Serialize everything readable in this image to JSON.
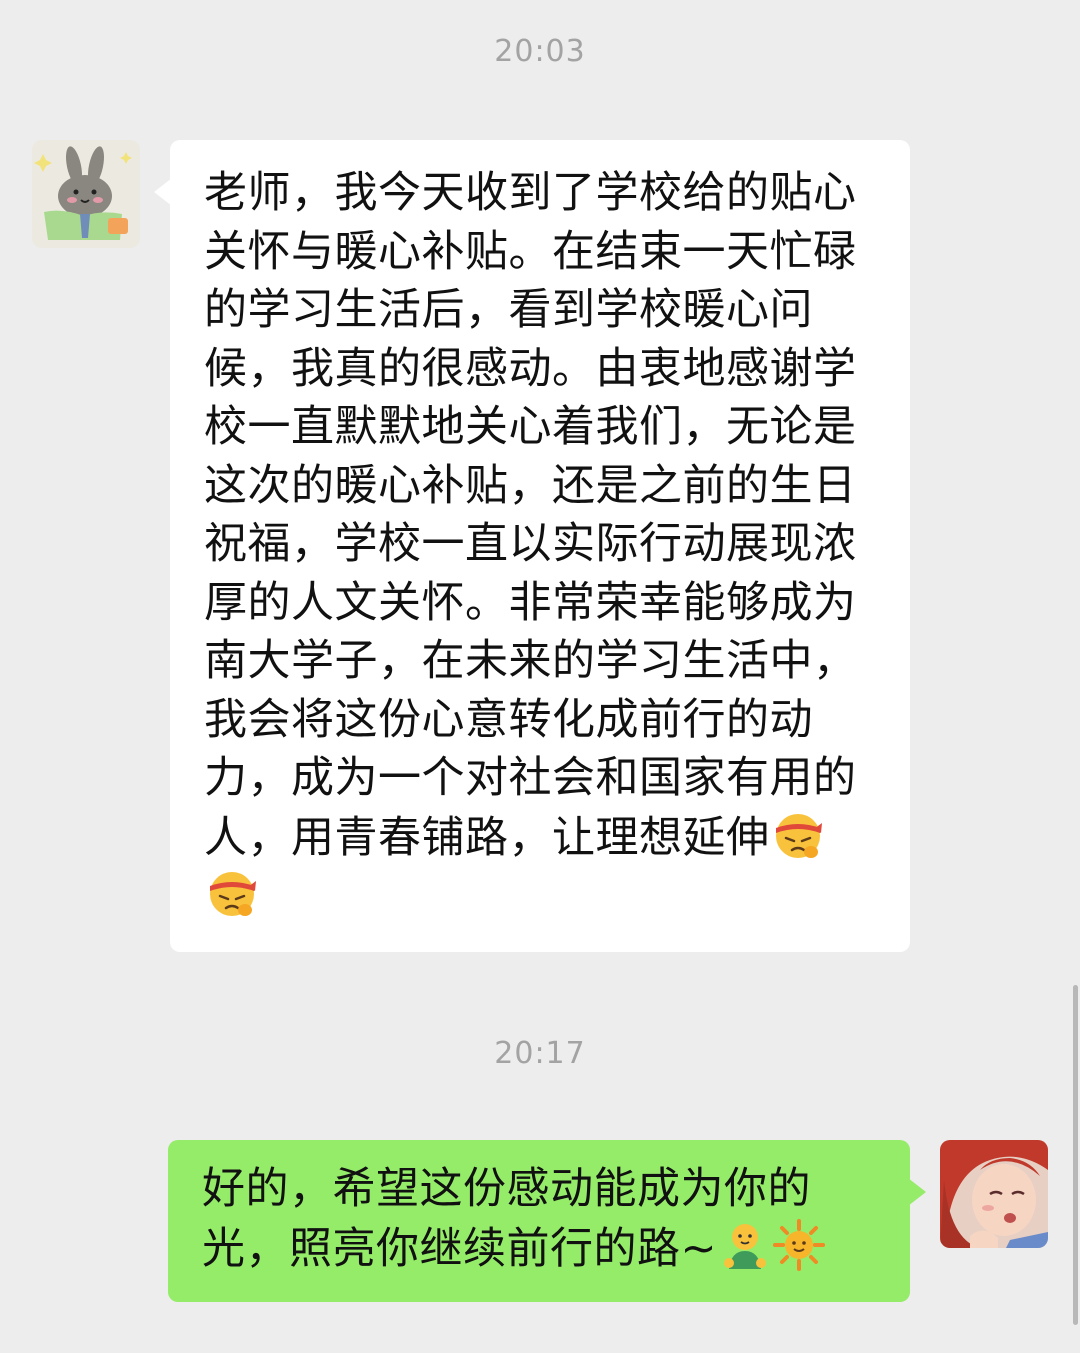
{
  "chat": {
    "messages": [
      {
        "time": "20:03",
        "sender": "other",
        "lines": [
          "老师，我今天收到了学校给的贴心",
          "关怀与暖心补贴。在结束一天忙碌",
          "的学习生活后，看到学校暖心问",
          "候，我真的很感动。由衷地感谢学",
          "校一直默默地关心着我们，无论是",
          "这次的暖心补贴，还是之前的生日",
          "祝福，学校一直以实际行动展现浓",
          "厚的人文关怀。非常荣幸能够成为",
          "南大学子，在未来的学习生活中，",
          "我会将这份心意转化成前行的动",
          "力，成为一个对社会和国家有用的",
          "人，用青春铺路，让理想延伸"
        ],
        "emojis": [
          "headband-determined-emoji",
          "headband-determined-emoji"
        ]
      },
      {
        "time": "20:17",
        "sender": "self",
        "lines": [
          "好的，希望这份感动能成为你的",
          "光，照亮你继续前行的路~"
        ],
        "emojis": [
          "green-figure-emoji",
          "sun-emoji"
        ]
      }
    ]
  },
  "colors": {
    "background": "#ededed",
    "incoming_bubble": "#ffffff",
    "outgoing_bubble": "#95ec69",
    "timestamp": "#a3a3a3"
  }
}
